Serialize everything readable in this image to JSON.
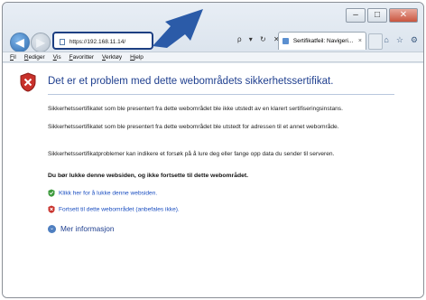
{
  "window": {
    "controls": [
      "–",
      "□",
      "✕"
    ]
  },
  "nav": {
    "back_icon": "back-arrow-icon",
    "forward_icon": "forward-arrow-icon"
  },
  "address_bar": {
    "value": "https://192.168.11.14/"
  },
  "address_controls": "ρ ▾ ↻ ✕",
  "tab": {
    "label": "Sertifikatfeil: Navigeri...",
    "close": "×"
  },
  "menu": [
    "Fil",
    "Rediger",
    "Vis",
    "Favoritter",
    "Verktøy",
    "Hjelp"
  ],
  "page": {
    "title": "Det er et problem med dette webområdets sikkerhetssertifikat.",
    "paragraphs": [
      "Sikkerhetssertifikatet som ble presentert fra dette webområdet ble ikke utstedt av en klarert sertifiseringsinstans.",
      "Sikkerhetssertifikatet som ble presentert fra dette webområdet ble utstedt for adressen til et annet webområde.",
      "Sikkerhetssertifikatproblemer kan indikere et forsøk på å lure deg eller fange opp data du sender til serveren."
    ],
    "warning": "Du bør lukke denne websiden, og ikke fortsette til dette webområdet.",
    "link_close": "Klikk her for å lukke denne websiden.",
    "link_continue": "Fortsett til dette webområdet (anbefales ikke).",
    "more_info": "Mer informasjon"
  },
  "colors": {
    "accent_arrow": "#2b5ba8",
    "title_blue": "#1f3f8f",
    "link_blue": "#1a4ec0",
    "warning_red": "#c8312b",
    "safe_green": "#3c9a3c"
  }
}
